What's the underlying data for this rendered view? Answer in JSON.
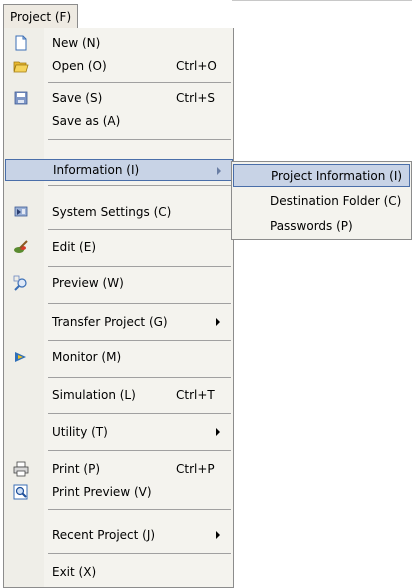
{
  "menubar": {
    "title": "Project (F)"
  },
  "menu": {
    "items": [
      {
        "label": "New (N)",
        "shortcut": ""
      },
      {
        "label": "Open  (O)",
        "shortcut": "Ctrl+O"
      },
      {
        "label": "Save  (S)",
        "shortcut": "Ctrl+S"
      },
      {
        "label": "Save as (A)",
        "shortcut": ""
      },
      {
        "label": "Information (I)",
        "shortcut": ""
      },
      {
        "label": "System Settings (C)",
        "shortcut": ""
      },
      {
        "label": "Edit (E)",
        "shortcut": ""
      },
      {
        "label": "Preview (W)",
        "shortcut": ""
      },
      {
        "label": "Transfer Project (G)",
        "shortcut": ""
      },
      {
        "label": "Monitor (M)",
        "shortcut": ""
      },
      {
        "label": "Simulation  (L)",
        "shortcut": "Ctrl+T"
      },
      {
        "label": "Utility (T)",
        "shortcut": ""
      },
      {
        "label": "Print  (P)",
        "shortcut": "Ctrl+P"
      },
      {
        "label": "Print Preview (V)",
        "shortcut": ""
      },
      {
        "label": "Recent Project (J)",
        "shortcut": ""
      },
      {
        "label": "Exit (X)",
        "shortcut": ""
      }
    ]
  },
  "submenu": {
    "items": [
      {
        "label": "Project Information (I)"
      },
      {
        "label": "Destination Folder (C)"
      },
      {
        "label": "Passwords (P)"
      }
    ]
  },
  "colors": {
    "highlight_fill": "#c8d3e6",
    "highlight_border": "#4a6ea9",
    "menu_bg": "#f4f3ee"
  }
}
